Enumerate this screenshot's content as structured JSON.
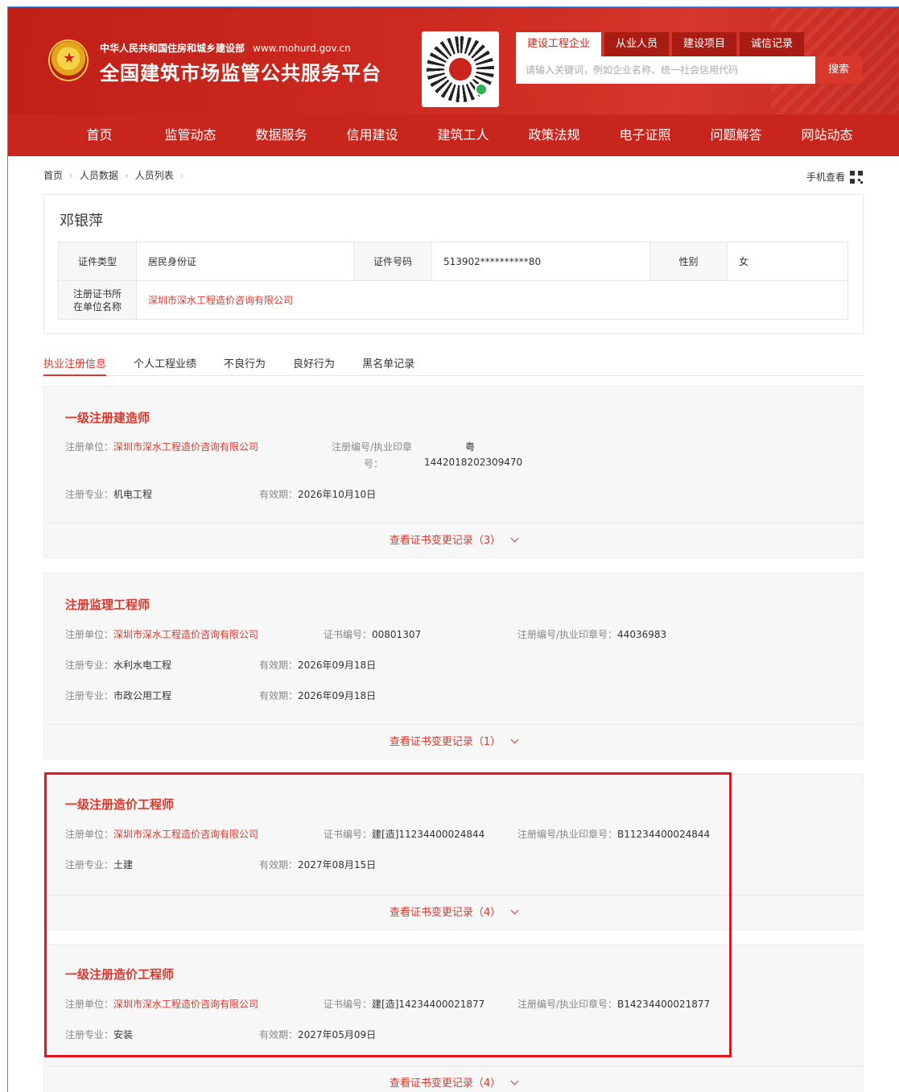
{
  "header": {
    "ministry": "中华人民共和国住房和城乡建设部",
    "url": "www.mohurd.gov.cn",
    "title": "全国建筑市场监管公共服务平台",
    "search_tabs": [
      "建设工程企业",
      "从业人员",
      "建设项目",
      "诚信记录"
    ],
    "search_placeholder": "请输入关键词，例如企业名称、统一社会信用代码",
    "search_button": "搜索"
  },
  "nav": [
    "首页",
    "监管动态",
    "数据服务",
    "信用建设",
    "建筑工人",
    "政策法规",
    "电子证照",
    "问题解答",
    "网站动态"
  ],
  "breadcrumb": [
    "首页",
    "人员数据",
    "人员列表"
  ],
  "mobile_view": "手机查看",
  "person": {
    "name": "邓银萍",
    "id_type_label": "证件类型",
    "id_type": "居民身份证",
    "id_no_label": "证件号码",
    "id_no": "513902**********80",
    "gender_label": "性别",
    "gender": "女",
    "company_label": "注册证书所在单位名称",
    "company": "深圳市深水工程造价咨询有限公司"
  },
  "tabs": [
    "执业注册信息",
    "个人工程业绩",
    "不良行为",
    "良好行为",
    "黑名单记录"
  ],
  "labels": {
    "unit": "注册单位：",
    "major": "注册专业：",
    "valid": "有效期：",
    "cert_no": "证书编号：",
    "reg_no": "注册编号/执业印章号：",
    "reg_no_a": "注册编号/执业印章",
    "reg_no_b": "号："
  },
  "certs": [
    {
      "title": "一级注册建造师",
      "unit": "深圳市深水工程造价咨询有限公司",
      "reg_prefix": "粤",
      "reg_no": "1442018202309470",
      "majors": [
        {
          "major": "机电工程",
          "valid": "2026年10月10日"
        }
      ],
      "footer": "查看证书变更记录（3）"
    },
    {
      "title": "注册监理工程师",
      "unit": "深圳市深水工程造价咨询有限公司",
      "cert_no": "00801307",
      "reg_no": "44036983",
      "majors": [
        {
          "major": "水利水电工程",
          "valid": "2026年09月18日"
        },
        {
          "major": "市政公用工程",
          "valid": "2026年09月18日"
        }
      ],
      "footer": "查看证书变更记录（1）"
    },
    {
      "title": "一级注册造价工程师",
      "unit": "深圳市深水工程造价咨询有限公司",
      "cert_no": "建[造]11234400024844",
      "reg_no": "B11234400024844",
      "majors": [
        {
          "major": "土建",
          "valid": "2027年08月15日"
        }
      ],
      "footer": "查看证书变更记录（4）"
    },
    {
      "title": "一级注册造价工程师",
      "unit": "深圳市深水工程造价咨询有限公司",
      "cert_no": "建[造]14234400021877",
      "reg_no": "B14234400021877",
      "majors": [
        {
          "major": "安装",
          "valid": "2027年05月09日"
        }
      ],
      "footer": "查看证书变更记录（4）"
    }
  ],
  "colors": {
    "brand_red": "#c8251d",
    "accent_red": "#d9372c",
    "highlight": "#e8141d"
  }
}
